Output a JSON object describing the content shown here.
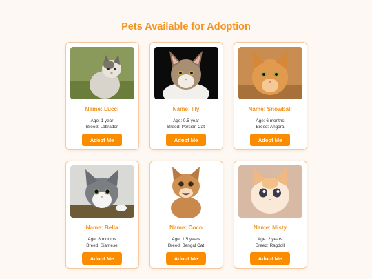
{
  "page": {
    "title": "Pets Available for Adoption"
  },
  "pets": [
    {
      "name": "Name: Lucci",
      "age": "Age: 1 year",
      "breed": "Breed: Labrador",
      "button": "Adopt Me"
    },
    {
      "name": "Name: Illy",
      "age": "Age: 0.5 year",
      "breed": "Breed: Persian Cat",
      "button": "Adopt Me"
    },
    {
      "name": "Name: Snowball",
      "age": "Age: 6 months",
      "breed": "Breed: Angora",
      "button": "Adopt Me"
    },
    {
      "name": "Name: Bella",
      "age": "Age: 8 months",
      "breed": "Breed: Siamese",
      "button": "Adopt Me"
    },
    {
      "name": "Name: Coco",
      "age": "Age: 1.5 years",
      "breed": "Breed: Bengal Cat",
      "button": "Adopt Me"
    },
    {
      "name": "Name: Misty",
      "age": "Age: 2 years",
      "breed": "Breed: Ragdoll",
      "button": "Adopt Me"
    }
  ],
  "colors": {
    "accent": "#f39322",
    "button": "#fb8c00",
    "background": "#fdf8f3",
    "card_border": "#f4c9a3"
  }
}
